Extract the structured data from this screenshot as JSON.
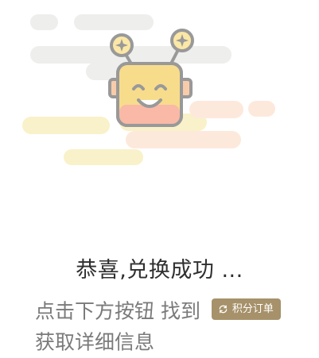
{
  "illustration": {
    "name": "happy-robot-mascot",
    "colors": {
      "cloud_gray": "#eeeeec",
      "cloud_yellow": "#f9f1c9",
      "cloud_peach": "#fde9dc",
      "face": "#f7dc8c",
      "outline": "#999999",
      "antenna_ball": "#fbe7a6"
    }
  },
  "result": {
    "title": "恭喜,兑换成功 ...",
    "desc_part1": "点击下方按钮 找到",
    "desc_part2": "获取详细信息",
    "orders_button": {
      "label": "积分订单",
      "icon": "refresh-icon",
      "color": "#a6916a"
    }
  }
}
